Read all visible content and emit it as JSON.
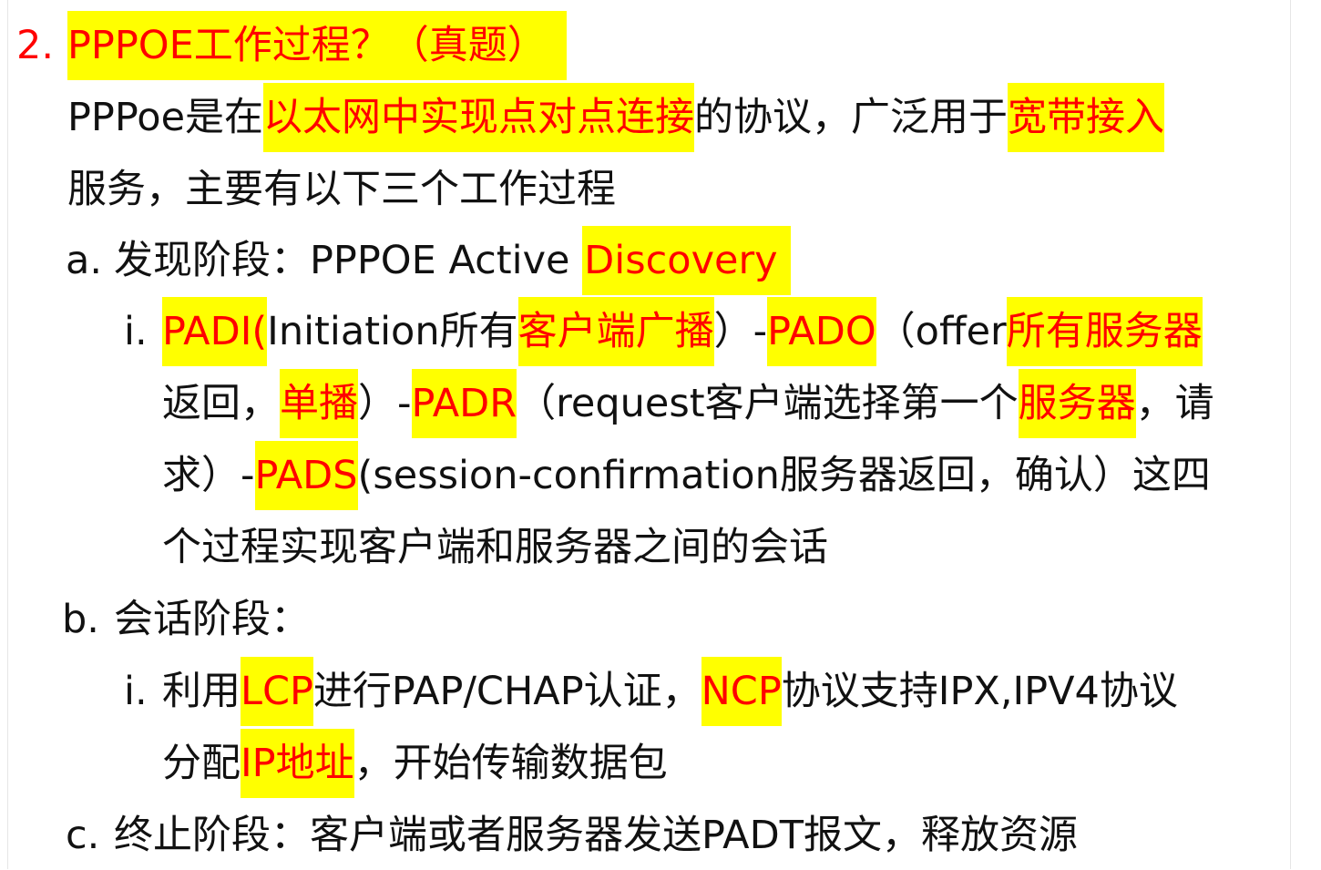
{
  "heading": {
    "number": "2.",
    "text": "PPPOE工作过程？（真题）"
  },
  "intro": {
    "line1": {
      "p1": "PPPoe是在",
      "h1": "以太网中实现点对点连接",
      "p2": "的协议，广泛用于",
      "h2": "宽带接入"
    },
    "line2": "服务，主要有以下三个工作过程"
  },
  "section_a": {
    "marker": "a.",
    "p1": "发现阶段：PPPOE Active ",
    "h1": "Discovery",
    "item_i": {
      "marker": "i.",
      "line1": {
        "h1": "PADI(",
        "p1": "Initiation所有",
        "h2": "客户端广播",
        "p2": "）-",
        "h3": "PADO",
        "p3": "（offer",
        "h4": "所有服务器"
      },
      "line2": {
        "p1": "返回，",
        "h1": "单播",
        "p2": "）-",
        "h2": "PADR",
        "p3": "（request客户端选择第一个",
        "h3": "服务器",
        "p4": "，请"
      },
      "line3": {
        "p1": "求）-",
        "h1": "PADS",
        "p2": "(session-confirmation服务器返回，确认）这四"
      },
      "line4": "个过程实现客户端和服务器之间的会话"
    }
  },
  "section_b": {
    "marker": "b.",
    "p1": "会话阶段：",
    "item_i": {
      "marker": "i.",
      "line1": {
        "p1": "利用",
        "h1": "LCP",
        "p2": "进行PAP/CHAP认证，",
        "h2": "NCP",
        "p3": "协议支持IPX,IPV4协议"
      },
      "line2": {
        "p1": "分配",
        "h1": "IP地址",
        "p2": "，开始传输数据包"
      }
    }
  },
  "section_c": {
    "marker": "c.",
    "text": "终止阶段：客户端或者服务器发送PADT报文，释放资源"
  },
  "colors": {
    "highlight": "#ffff00",
    "emphasis_text": "#ff0000",
    "body_text": "#111111"
  }
}
